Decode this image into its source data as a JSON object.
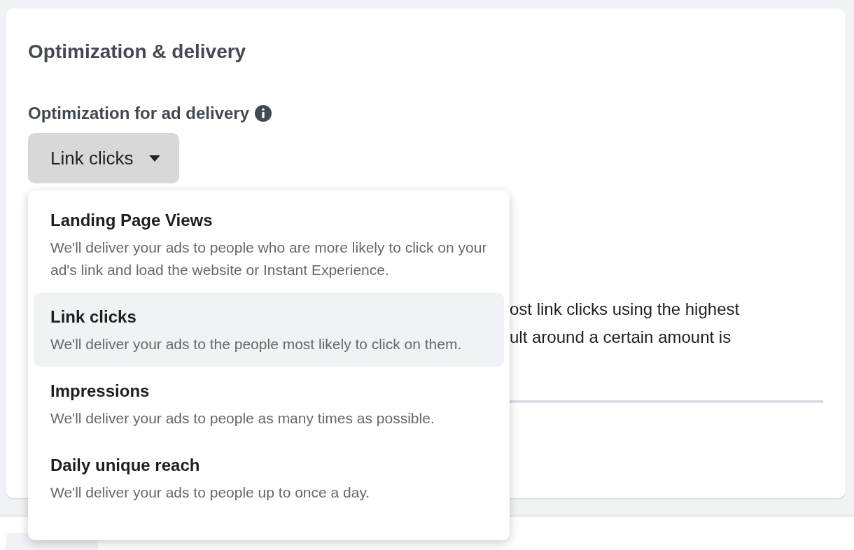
{
  "section": {
    "title": "Optimization & delivery",
    "field_label": "Optimization for ad delivery",
    "dropdown": {
      "value": "Link clicks",
      "expanded": true
    },
    "hidden_description": [
      "ost link clicks using the highest",
      "ult around a certain amount is"
    ]
  },
  "menu": {
    "items": [
      {
        "title": "Landing Page Views",
        "description": "We'll deliver your ads to people who are more likely to click on your ad's link and load the website or Instant Experience.",
        "selected": false
      },
      {
        "title": "Link clicks",
        "description": "We'll deliver your ads to the people most likely to click on them.",
        "selected": true
      },
      {
        "title": "Impressions",
        "description": "We'll deliver your ads to people as many times as possible.",
        "selected": false
      },
      {
        "title": "Daily unique reach",
        "description": "We'll deliver your ads to people up to once a day.",
        "selected": false
      }
    ]
  }
}
